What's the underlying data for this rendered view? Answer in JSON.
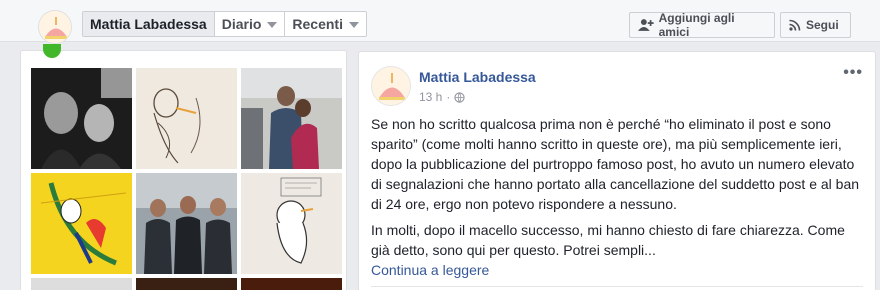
{
  "header": {
    "tabs": [
      {
        "label": "Mattia Labadessa"
      },
      {
        "label": "Diario"
      },
      {
        "label": "Recenti"
      }
    ],
    "add_friend_label": "Aggiungi agli amici",
    "follow_label": "Segui"
  },
  "post": {
    "author": "Mattia Labadessa",
    "time": "13 h",
    "paragraphs": [
      "Se non ho scritto qualcosa prima non è perché “ho eliminato il post e sono sparito” (come molti hanno scritto in queste ore), ma più semplicemente ieri, dopo la pubblicazione del purtroppo famoso post, ho avuto un numero elevato di segnalazioni che hanno portato alla cancellazione del suddetto post e al ban di 24 ore, ergo non potevo rispondere a nessuno.",
      "In molti, dopo il macello successo, mi hanno chiesto di fare chiarezza. Come già detto, sono qui per questo. Potrei sempli..."
    ],
    "continue_label": "Continua a leggere",
    "more_label": "•••"
  },
  "colors": {
    "link": "#365899",
    "accent_green": "#42b72a"
  },
  "icons": {
    "privacy": "globe-icon",
    "add_friend": "add-friend-icon",
    "follow": "rss-icon"
  }
}
